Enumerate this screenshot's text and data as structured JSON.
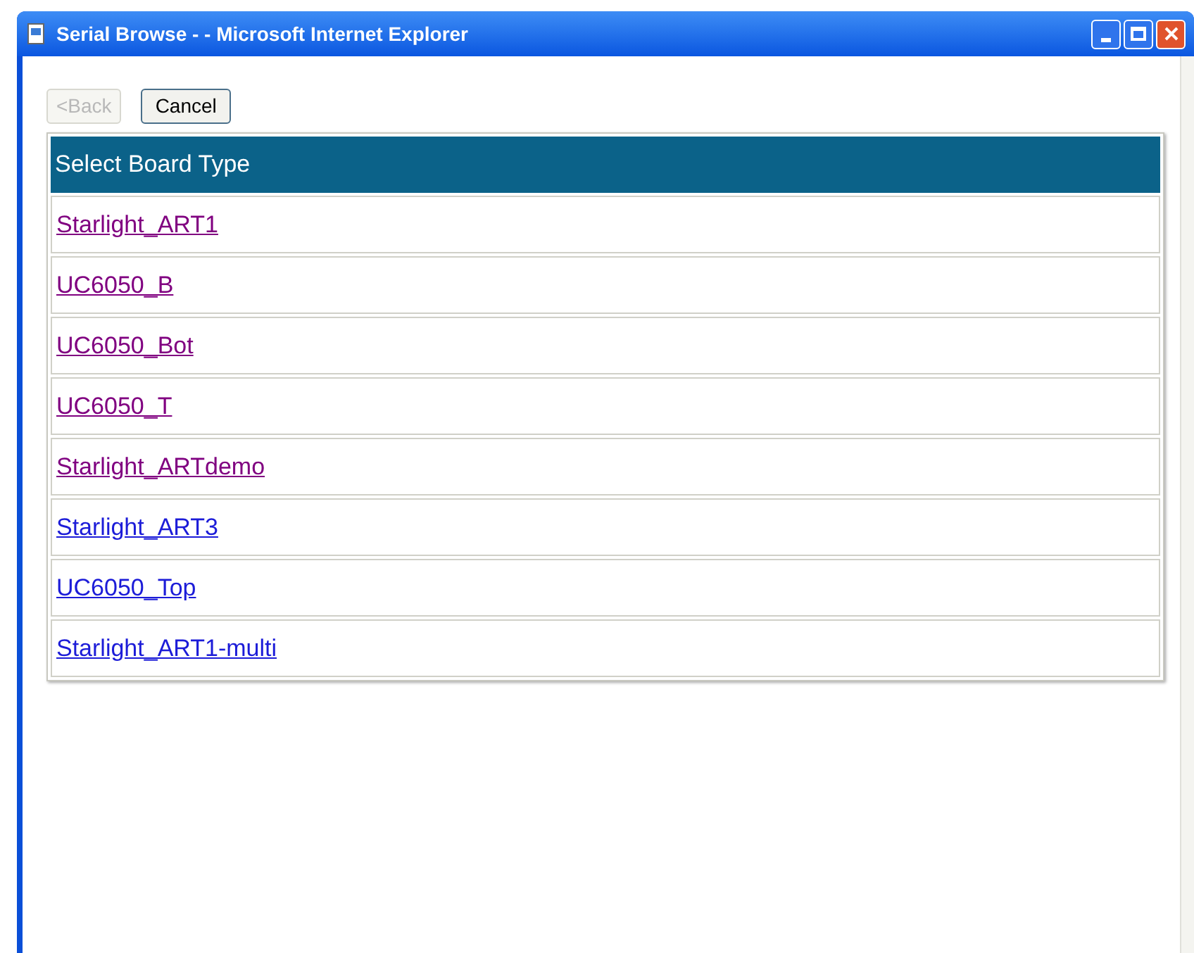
{
  "window": {
    "title": "Serial Browse - - Microsoft Internet Explorer"
  },
  "buttons": [
    {
      "label": "<Back",
      "disabled": true
    },
    {
      "label": "Cancel",
      "disabled": false
    }
  ],
  "table": {
    "header": "Select Board Type",
    "rows": [
      {
        "label": "Starlight_ART1",
        "visited": true
      },
      {
        "label": "UC6050_B",
        "visited": true
      },
      {
        "label": "UC6050_Bot",
        "visited": true
      },
      {
        "label": "UC6050_T",
        "visited": true
      },
      {
        "label": "Starlight_ARTdemo",
        "visited": true
      },
      {
        "label": "Starlight_ART3",
        "visited": false
      },
      {
        "label": "UC6050_Top",
        "visited": false
      },
      {
        "label": "Starlight_ART1-multi",
        "visited": false
      }
    ]
  }
}
